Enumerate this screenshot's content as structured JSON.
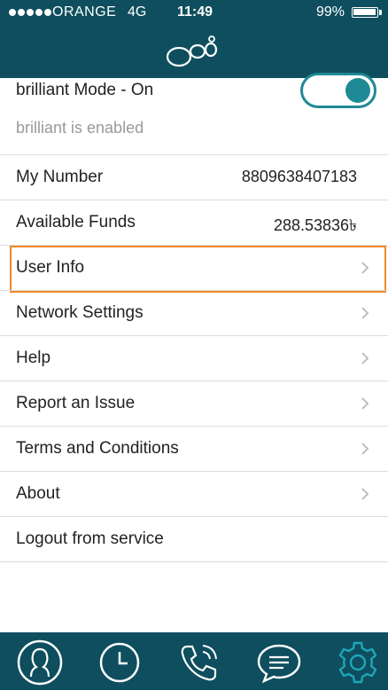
{
  "status_bar": {
    "carrier": "ORANGE",
    "network": "4G",
    "time": "11:49",
    "battery_percent": "99%",
    "battery_level": 0.99,
    "signal_bars": 5,
    "battery_icon": "battery-icon",
    "signal_icon": "signal-dots-icon"
  },
  "header": {
    "logo_icon": "brand-bubbles-logo"
  },
  "mode": {
    "title": "brilliant Mode - On",
    "subtitle": "brilliant is enabled",
    "toggle_on": true
  },
  "info_rows": [
    {
      "label": "My Number",
      "value": "8809638407183"
    },
    {
      "label": "Available Funds",
      "value": "288.53836৳"
    }
  ],
  "menu": [
    {
      "label": "User Info",
      "chevron": true,
      "highlighted": true
    },
    {
      "label": "Network Settings",
      "chevron": true
    },
    {
      "label": "Help",
      "chevron": true
    },
    {
      "label": "Report an Issue",
      "chevron": true
    },
    {
      "label": "Terms and Conditions",
      "chevron": true
    },
    {
      "label": "About",
      "chevron": true
    },
    {
      "label": "Logout from service",
      "chevron": false
    }
  ],
  "tabbar": {
    "tabs": [
      {
        "icon": "contacts-icon"
      },
      {
        "icon": "recents-clock-icon"
      },
      {
        "icon": "phone-call-icon"
      },
      {
        "icon": "messages-icon"
      },
      {
        "icon": "settings-gear-icon",
        "active": true
      }
    ]
  },
  "colors": {
    "brand_teal": "#0e4e5e",
    "accent_teal": "#1e8a96",
    "highlight_orange": "#f0892a",
    "divider": "#dcdcdc"
  }
}
